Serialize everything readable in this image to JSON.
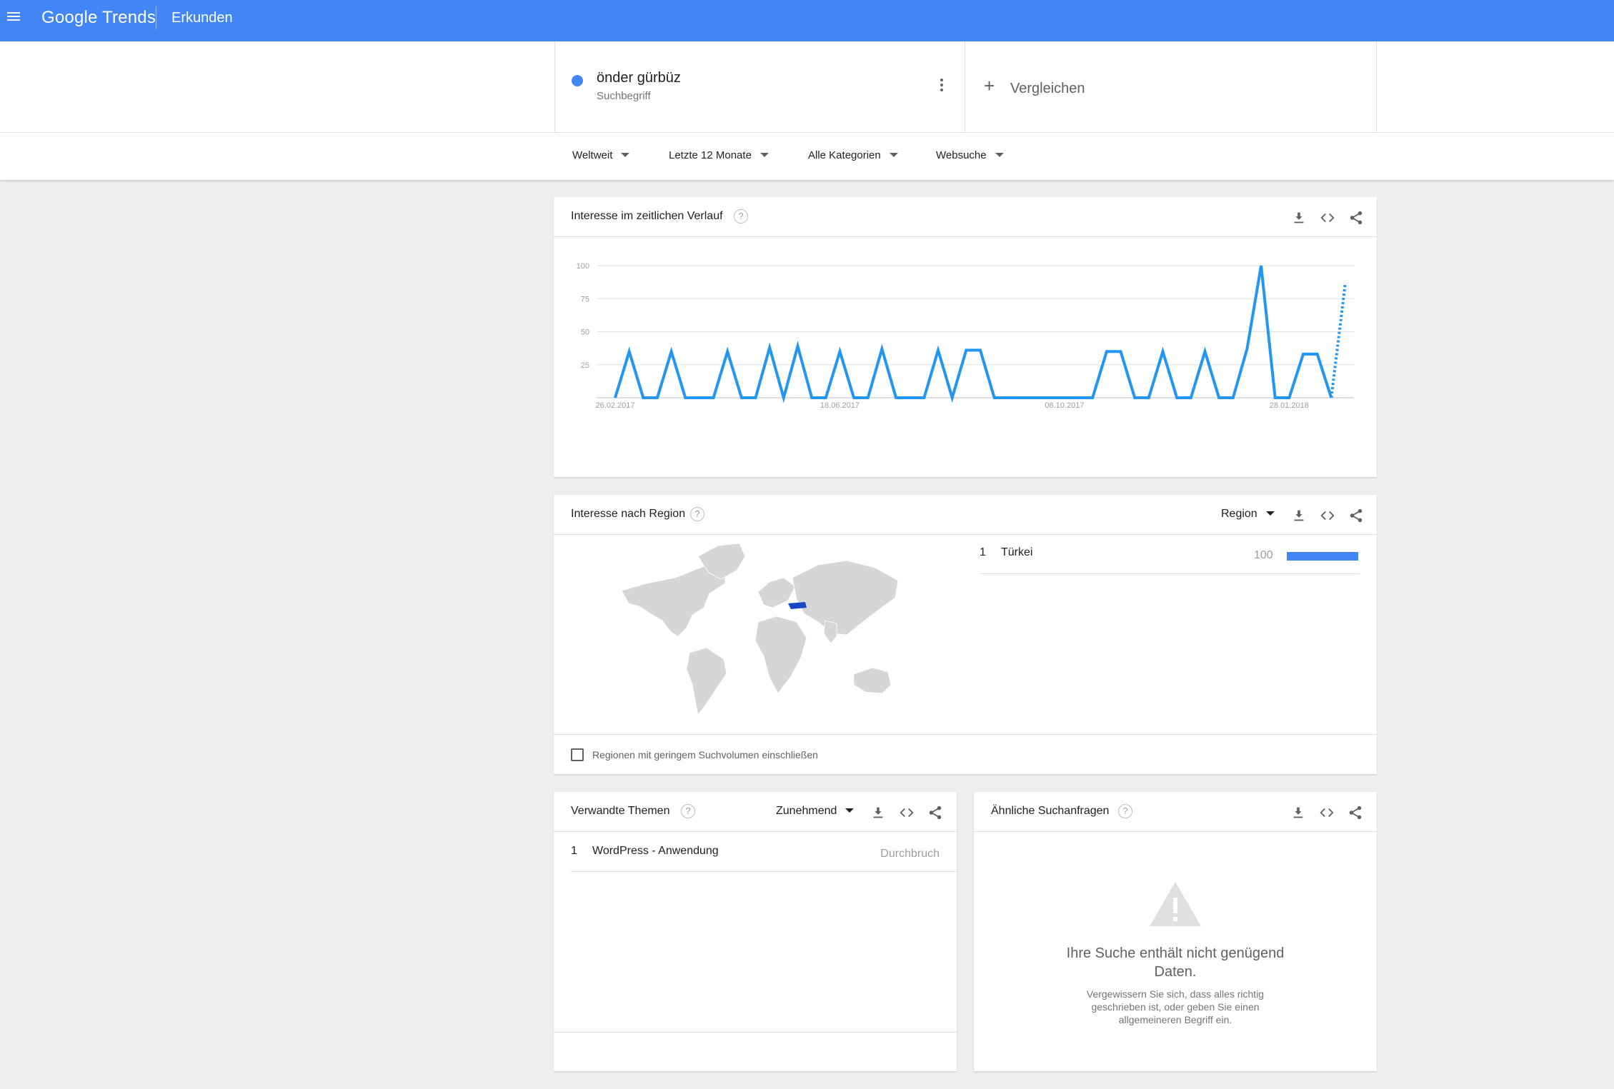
{
  "header": {
    "logo": "Google Trends",
    "nav_title": "Erkunden",
    "icons": {
      "menu": "hamburger-menu-icon"
    }
  },
  "search": {
    "term": "önder gürbüz",
    "term_type": "Suchbegriff",
    "term_color": "#4285f4",
    "compare_label": "Vergleichen"
  },
  "filters": {
    "location": "Weltweit",
    "time": "Letzte 12 Monate",
    "category": "Alle Kategorien",
    "search_type": "Websuche"
  },
  "interest_over_time": {
    "title": "Interesse im zeitlichen Verlauf",
    "help": "?"
  },
  "interest_by_region": {
    "title": "Interesse nach Region",
    "help": "?",
    "dropdown": "Region",
    "rows": [
      {
        "rank": "1",
        "label": "Türkei",
        "value": "100",
        "fraction": 1.0
      }
    ],
    "checkbox_label": "Regionen mit geringem Suchvolumen einschließen",
    "highlight_color": "#1a47c4"
  },
  "related_topics": {
    "title": "Verwandte Themen",
    "help": "?",
    "dropdown": "Zunehmend",
    "rows": [
      {
        "rank": "1",
        "label": "WordPress - Anwendung",
        "value": "Durchbruch"
      }
    ]
  },
  "related_queries": {
    "title": "Ähnliche Suchanfragen",
    "help": "?",
    "no_data_title_1": "Ihre Suche enthält nicht genügend",
    "no_data_title_2": "Daten.",
    "no_data_text_1": "Vergewissern Sie sich, dass alles richtig",
    "no_data_text_2": "geschrieben ist, oder geben Sie einen",
    "no_data_text_3": "allgemeineren Begriff ein.",
    "warning_icon": "warning-triangle-icon"
  },
  "chart_data": {
    "type": "line",
    "title": "Interesse im zeitlichen Verlauf",
    "xlabel": "",
    "ylabel": "",
    "ylim": [
      0,
      100
    ],
    "yticks": [
      "25",
      "50",
      "75",
      "100"
    ],
    "xtick_labels": [
      "26.02.2017",
      "18.06.2017",
      "08.10.2017",
      "28.01.2018"
    ],
    "xtick_indices": [
      0,
      16,
      32,
      48
    ],
    "grid": true,
    "line_color": "#2196f3",
    "series": [
      {
        "name": "önder gürbüz",
        "values": [
          0,
          35,
          0,
          0,
          35,
          0,
          0,
          0,
          35,
          0,
          0,
          38,
          0,
          39,
          0,
          0,
          35,
          0,
          0,
          37,
          0,
          0,
          0,
          36,
          0,
          36,
          36,
          0,
          0,
          0,
          0,
          0,
          0,
          0,
          0,
          35,
          35,
          0,
          0,
          35,
          0,
          0,
          35,
          0,
          0,
          37,
          100,
          0,
          0,
          33,
          33,
          0,
          87
        ],
        "partial_from_index": 51
      }
    ]
  }
}
